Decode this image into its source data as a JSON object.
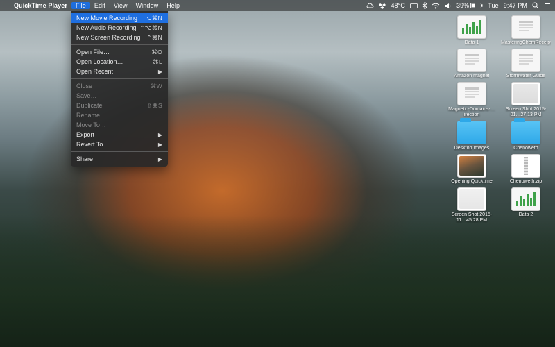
{
  "menubar": {
    "app_name": "QuickTime Player",
    "items": [
      "File",
      "Edit",
      "View",
      "Window",
      "Help"
    ],
    "open_index": 0,
    "status": {
      "temp": "48°C",
      "battery": "39%",
      "day": "Tue",
      "time": "9:47 PM"
    }
  },
  "file_menu": [
    {
      "label": "New Movie Recording",
      "shortcut": "⌥⌘N",
      "highlighted": true
    },
    {
      "label": "New Audio Recording",
      "shortcut": "⌃⌥⌘N"
    },
    {
      "label": "New Screen Recording",
      "shortcut": "⌃⌘N"
    },
    {
      "sep": true
    },
    {
      "label": "Open File…",
      "shortcut": "⌘O"
    },
    {
      "label": "Open Location…",
      "shortcut": "⌘L"
    },
    {
      "label": "Open Recent",
      "submenu": true
    },
    {
      "sep": true
    },
    {
      "label": "Close",
      "shortcut": "⌘W",
      "disabled": true
    },
    {
      "label": "Save…",
      "disabled": true
    },
    {
      "label": "Duplicate",
      "shortcut": "⇧⌘S",
      "disabled": true
    },
    {
      "label": "Rename…",
      "disabled": true
    },
    {
      "label": "Move To…",
      "disabled": true
    },
    {
      "label": "Export",
      "submenu": true
    },
    {
      "label": "Revert To",
      "submenu": true
    },
    {
      "sep": true
    },
    {
      "label": "Share",
      "submenu": true
    }
  ],
  "desktop": {
    "icons": [
      {
        "name": "Data 1",
        "kind": "chart"
      },
      {
        "name": "MasteringChemReceipt",
        "kind": "doc"
      },
      {
        "name": "Amazon magnet",
        "kind": "doc"
      },
      {
        "name": "Stormwater Guide",
        "kind": "doc"
      },
      {
        "name": "Magnetic-Domains-…irection",
        "kind": "doc"
      },
      {
        "name": "Screen Shot 2015-01…27.13 PM",
        "kind": "image",
        "bg": "linear-gradient(#e8e8e8,#dcdcdc)"
      },
      {
        "name": "Desktop Images",
        "kind": "folder"
      },
      {
        "name": "Chenoweth",
        "kind": "folder"
      },
      {
        "name": "Opening Quicktime",
        "kind": "image",
        "bg": "linear-gradient(160deg,#d08040 0%,#6a553f 50%,#2e3a30 100%)"
      },
      {
        "name": "Chenoweth.zip",
        "kind": "zip"
      },
      {
        "name": "Screen Shot 2015-11…45.28 PM",
        "kind": "image",
        "bg": "linear-gradient(#f0f0f0,#e6e6e6)"
      },
      {
        "name": "Data 2",
        "kind": "chart"
      }
    ]
  }
}
